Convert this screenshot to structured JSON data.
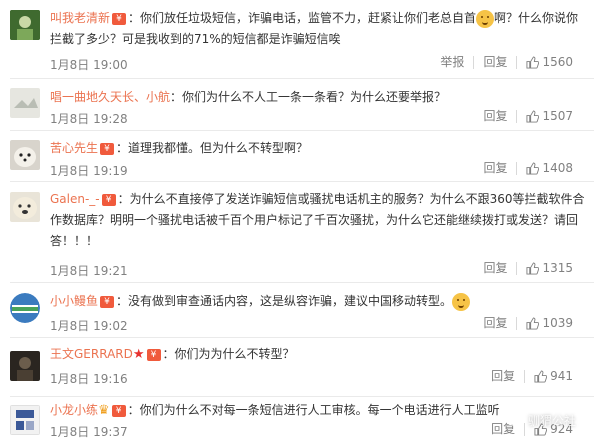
{
  "comments": [
    {
      "user": "叫我老清新",
      "badge": "vip",
      "text": "：你们放任垃圾短信，诈骗电话，监管不力，赶紧让你们老总自首",
      "text_after_emoji": "啊？什么你说你拦截了多少？可是我收到的71%的短信都是诈骗短信唉",
      "time": "1月8日 19:00",
      "report": "举报",
      "reply": "回复",
      "likes": "1560"
    },
    {
      "user": "唱一曲地久天长、小航",
      "badge": "",
      "text": "：你们为什么不人工一条一条看？为什么还要举报？",
      "time": "1月8日 19:28",
      "reply": "回复",
      "likes": "1507"
    },
    {
      "user": "苦心先生",
      "badge": "vip",
      "text": "：道理我都懂。但为什么不转型啊？",
      "time": "1月8日 19:19",
      "reply": "回复",
      "likes": "1408"
    },
    {
      "user": "Galen-_-",
      "badge": "vip",
      "text": "：为什么不直接停了发送诈骗短信或骚扰电话机主的服务？为什么不跟360等拦截软件合作数据库？明明一个骚扰电话被千百个用户标记了千百次骚扰，为什么它还能继续拨打或发送？请回答！！！",
      "time": "1月8日 19:21",
      "reply": "回复",
      "likes": "1315"
    },
    {
      "user": "小小鳗鱼",
      "badge": "vip",
      "text": "：没有做到审查通话内容，这是纵容诈骗，建议中国移动转型。",
      "time": "1月8日 19:02",
      "reply": "回复",
      "likes": "1039"
    },
    {
      "user": "王文GERRARD",
      "badge": "vip",
      "text": "：你们为为什么不转型？",
      "time": "1月8日 19:16",
      "reply": "回复",
      "likes": "941"
    },
    {
      "user": "小龙小练",
      "badge": "vip",
      "text": "：你们为什么不对每一条短信进行人工审核。每一个电话进行人工监听",
      "time": "1月8日 19:37",
      "reply": "回复",
      "likes": "924"
    }
  ],
  "watermark": "驯猬公社",
  "colors": {
    "username": "#eb7350",
    "meta": "#808080",
    "divider": "#eaeaea"
  }
}
